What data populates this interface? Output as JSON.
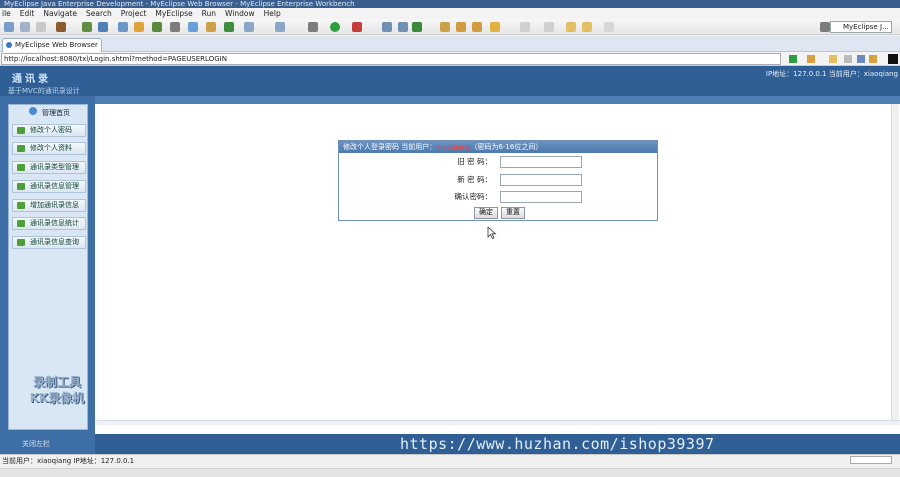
{
  "window": {
    "title": "MyEclipse Java Enterprise Development - MyEclipse Web Browser - MyEclipse Enterprise Workbench"
  },
  "menu": [
    "ile",
    "Edit",
    "Navigate",
    "Search",
    "Project",
    "MyEclipse",
    "Run",
    "Window",
    "Help"
  ],
  "toolbar": {
    "perspective_label": "MyEclipse J..."
  },
  "browser": {
    "tab_label": "MyEclipse Web Browser",
    "address": "http://localhost:8080/txl/Login.shtml?method=PAGEUSERLOGIN"
  },
  "page": {
    "logo": "通讯录",
    "system_name": "基于MVC的通讯录设计",
    "user_info": "IP地址：127.0.0.1 当前用户：xiaoqiang",
    "sidebar": {
      "title": "管理首页",
      "items": [
        {
          "label": "修改个人密码"
        },
        {
          "label": "修改个人资料"
        },
        {
          "label": "通讯录类型管理"
        },
        {
          "label": "通讯录信息管理"
        },
        {
          "label": "增加通讯录信息"
        },
        {
          "label": "通讯录信息统计"
        },
        {
          "label": "通讯录信息查询"
        }
      ],
      "footer_label": "关闭左栏"
    },
    "watermark": [
      "录制工具",
      "KK录像机"
    ],
    "url_watermark": "https://www.huzhan.com/ishop39397"
  },
  "dialog": {
    "title_prefix": "修改个人登录密码 当前用户：",
    "current_user": "xiaoqiang",
    "title_suffix": "（密码为6-16位之间）",
    "fields": [
      {
        "label": "旧 密 码：",
        "value": ""
      },
      {
        "label": "新 密 码：",
        "value": ""
      },
      {
        "label": "确认密码：",
        "value": ""
      }
    ],
    "submit_label": "确定",
    "reset_label": "重置"
  },
  "status": {
    "text": "当前用户：xiaoqiang  IP地址：127.0.0.1"
  },
  "colors": {
    "banner": "#2f5f95",
    "sidebar": "#3d6ea6",
    "dialog_header": "#4d79ad",
    "user_highlight": "#ff3b3b"
  }
}
